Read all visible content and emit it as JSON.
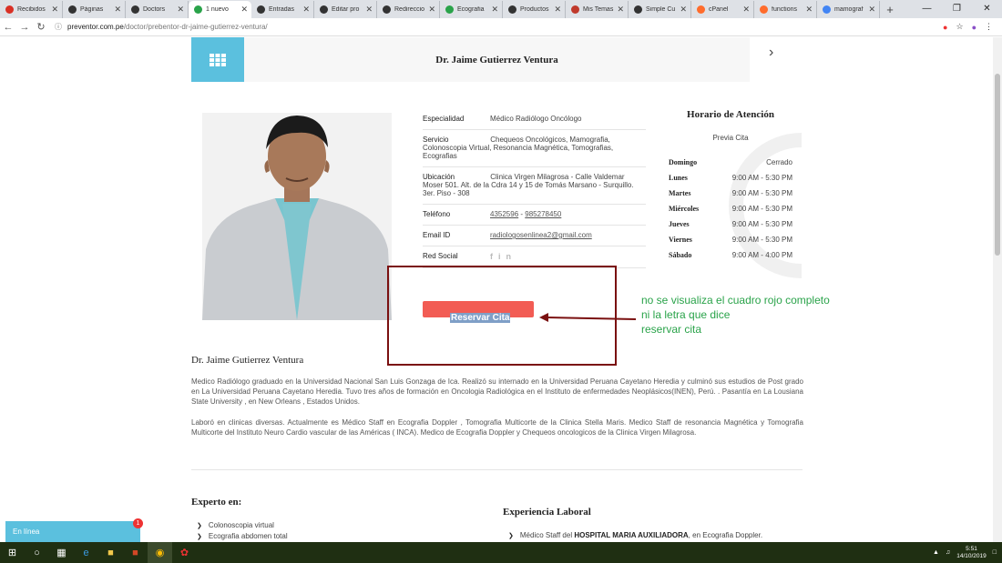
{
  "browser": {
    "tabs": [
      {
        "label": "Recibidos",
        "icon": "gmail-icon",
        "color": "#d93025"
      },
      {
        "label": "Páginas",
        "icon": "wordpress-icon",
        "color": "#333333"
      },
      {
        "label": "Doctors",
        "icon": "wordpress-icon",
        "color": "#333333"
      },
      {
        "label": "1 nuevo",
        "icon": "site-icon",
        "color": "#2aa34a",
        "active": true
      },
      {
        "label": "Entradas",
        "icon": "wordpress-icon",
        "color": "#333333"
      },
      {
        "label": "Editar pro",
        "icon": "wordpress-icon",
        "color": "#333333"
      },
      {
        "label": "Redireccio",
        "icon": "wordpress-icon",
        "color": "#333333"
      },
      {
        "label": "Ecografia",
        "icon": "site-icon",
        "color": "#2aa34a"
      },
      {
        "label": "Productos",
        "icon": "wordpress-icon",
        "color": "#333333"
      },
      {
        "label": "Mis Temas",
        "icon": "themeforest-icon",
        "color": "#c0392b"
      },
      {
        "label": "Simple Cu",
        "icon": "wordpress-icon",
        "color": "#333333"
      },
      {
        "label": "cPanel",
        "icon": "cpanel-icon",
        "color": "#ff6c2c"
      },
      {
        "label": "functions",
        "icon": "cpanel-icon",
        "color": "#ff6c2c"
      },
      {
        "label": "mamograf",
        "icon": "google-icon",
        "color": "#4285f4"
      }
    ],
    "new_tab": "+",
    "url_host": "preventor.com.pe",
    "url_path": "/doctor/prebentor-dr-jaime-gutierrez-ventura/"
  },
  "doctor": {
    "header_name": "Dr. Jaime Gutierrez Ventura",
    "fields": [
      {
        "key": "Especialidad",
        "value": "Médico Radiólogo Oncólogo"
      },
      {
        "key": "Servicio",
        "value": "Chequeos Oncológicos, Mamografia, Colonoscopia Virtual, Resonancia Magnética, Tomografias, Ecografias"
      },
      {
        "key": "Ubicación",
        "value": "Clinica Virgen Milagrosa - Calle Valdemar Moser 501. Alt. de la Cdra 14 y 15 de Tomás Marsano - Surquillo. 3er. Piso - 308"
      }
    ],
    "phone_label": "Teléfono",
    "phone_1": "4352596",
    "phone_sep": " - ",
    "phone_2": "985278450",
    "email_label": "Email ID",
    "email": "radiologosenlinea2@gmail.com",
    "social_label": "Red Social",
    "social_icons": [
      "facebook-icon",
      "linkedin-icon"
    ],
    "book_label": "Reservar Cita",
    "name": "Dr. Jaime Gutierrez Ventura",
    "bio": [
      "Medico Radiólogo graduado en la Universidad Nacional San Luis Gonzaga de Ica. Realizó su internado en la Universidad Peruana Cayetano Heredia y culminó sus estudios de Post grado en La Universidad Peruana Cayetano Heredia. Tuvo tres años de formación en Oncologia Radiológica en el Instituto de enfermedades Neoplásicos(INEN), Perú. . Pasantía en La Lousiana State University , en New Orleans , Estados Unidos.",
      "Laboró en clinicas diversas. Actualmente es Médico Staff en Ecografia Doppler , Tomografia Multicorte de la Clinica Stella Maris. Medico Staff de resonancia Magnética y Tomografia Multicorte del Instituto Neuro Cardio vascular de las Américas ( INCA). Medico de Ecografia Doppler y Chequeos oncologicos de la Clinica Virgen Milagrosa."
    ],
    "expert_title": "Experto en:",
    "expert_items": [
      "Colonoscopia virtual",
      "Ecografia abdomen total"
    ],
    "work_title": "Experiencia Laboral",
    "work_items": [
      {
        "pre": "Médico Staff del ",
        "bold": "HOSPITAL MARIA AUXILIADORA",
        "post": ", en Ecografia Doppler."
      }
    ]
  },
  "schedule": {
    "title": "Horario de Atención",
    "note": "Previa Cita",
    "rows": [
      {
        "day": "Domingo",
        "hours": "Cerrado"
      },
      {
        "day": "Lunes",
        "hours": "9:00 AM - 5:30 PM"
      },
      {
        "day": "Martes",
        "hours": "9:00 AM - 5:30 PM"
      },
      {
        "day": "Miércoles",
        "hours": "9:00 AM - 5:30 PM"
      },
      {
        "day": "Jueves",
        "hours": "9:00 AM - 5:30 PM"
      },
      {
        "day": "Viernes",
        "hours": "9:00 AM - 5:30 PM"
      },
      {
        "day": "Sábado",
        "hours": "9:00 AM - 4:00 PM"
      }
    ]
  },
  "annotation": {
    "lines": [
      "no se visualiza el cuadro rojo completo",
      "ni la letra que dice",
      "reservar cita"
    ],
    "color": "#2aa34a",
    "box_color": "#7a1010"
  },
  "chat": {
    "label": "En línea",
    "badge": "1"
  },
  "taskbar": {
    "time": "5:51",
    "date": "14/10/2019"
  },
  "colors": {
    "accent": "#5bc0de",
    "button": "#f25c54"
  }
}
